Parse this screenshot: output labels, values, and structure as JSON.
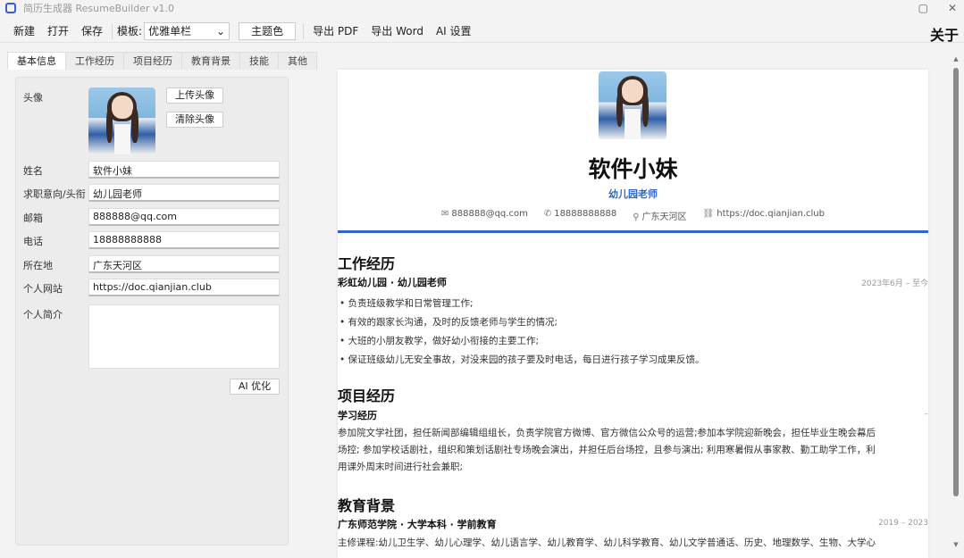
{
  "app": {
    "title": "简历生成器 ResumeBuilder  v1.0"
  },
  "window": {
    "minimize": "▢",
    "close": "✕"
  },
  "toolbar": {
    "new": "新建",
    "open": "打开",
    "save": "保存",
    "template_label": "模板:",
    "template_value": "优雅单栏",
    "theme_color": "主题色",
    "export_pdf": "导出 PDF",
    "export_word": "导出 Word",
    "ai_settings": "AI 设置",
    "about": "关于"
  },
  "tabs": [
    "基本信息",
    "工作经历",
    "项目经历",
    "教育背景",
    "技能",
    "其他"
  ],
  "form": {
    "avatar_label": "头像",
    "upload_avatar": "上传头像",
    "clear_avatar": "清除头像",
    "fields": [
      {
        "label": "姓名",
        "value": "软件小妹"
      },
      {
        "label": "求职意向/头衔",
        "value": "幼儿园老师"
      },
      {
        "label": "邮箱",
        "value": "888888@qq.com"
      },
      {
        "label": "电话",
        "value": "18888888888"
      },
      {
        "label": "所在地",
        "value": "广东天河区"
      },
      {
        "label": "个人网站",
        "value": "https://doc.qianjian.club"
      }
    ],
    "bio_label": "个人简介",
    "ai_optimize": "AI 优化"
  },
  "resume": {
    "name": "软件小妹",
    "title": "幼儿园老师",
    "contacts": {
      "email": "888888@qq.com",
      "phone": "18888888888",
      "location": "广东天河区",
      "website": "https://doc.qianjian.club"
    },
    "work": {
      "heading": "工作经历",
      "entry": "彩虹幼儿园 · 幼儿园老师",
      "date": "2023年6月 – 至今",
      "bullets": [
        "负责班级教学和日常管理工作;",
        "有效的跟家长沟通，及时的反馈老师与学生的情况;",
        "大班的小朋友教学，做好幼小衔接的主要工作;",
        "保证班级幼儿无安全事故，对没来园的孩子要及时电话，每日进行孩子学习成果反馈。"
      ]
    },
    "project": {
      "heading": "项目经历",
      "entry": "学习经历",
      "date": "–",
      "lines": [
        "参加院文学社团，担任新闻部编辑组组长，负责学院官方微博、官方微信公众号的运营;参加本学院迎新晚会，担任毕业生晚会幕后",
        "场控; 参加学校话剧社，组织和策划话剧社专场晚会演出，并担任后台场控，且参与演出; 利用寒暑假从事家教、勤工助学工作，利",
        "用课外周末时间进行社会兼职;"
      ]
    },
    "education": {
      "heading": "教育背景",
      "entry": "广东师范学院 · 大学本科 · 学前教育",
      "date": "2019 – 2023",
      "line": "主修课程:幼儿卫生学、幼儿心理学、幼儿语言学、幼儿教育学、幼儿科学教育、幼儿文学普通话、历史、地理数学、生物、大学心"
    }
  }
}
